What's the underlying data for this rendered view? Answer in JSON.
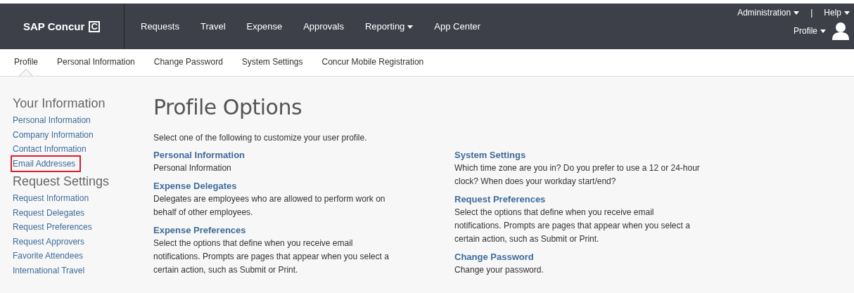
{
  "header": {
    "logo": "SAP Concur",
    "logo_mark": "C",
    "nav": [
      {
        "label": "Requests",
        "has_menu": false
      },
      {
        "label": "Travel",
        "has_menu": false
      },
      {
        "label": "Expense",
        "has_menu": false
      },
      {
        "label": "Approvals",
        "has_menu": false
      },
      {
        "label": "Reporting",
        "has_menu": true
      },
      {
        "label": "App Center",
        "has_menu": false
      }
    ],
    "utility": [
      {
        "label": "Administration",
        "has_menu": true
      },
      {
        "label": "Help",
        "has_menu": true
      }
    ],
    "separator": "|",
    "profile": {
      "label": "Profile",
      "has_menu": true
    }
  },
  "subnav": [
    {
      "label": "Profile",
      "selected": true
    },
    {
      "label": "Personal Information",
      "selected": false
    },
    {
      "label": "Change Password",
      "selected": false
    },
    {
      "label": "System Settings",
      "selected": false
    },
    {
      "label": "Concur Mobile Registration",
      "selected": false
    }
  ],
  "sidebar": [
    {
      "title": "Your Information",
      "items": [
        {
          "label": "Personal Information",
          "highlighted": false
        },
        {
          "label": "Company Information",
          "highlighted": false
        },
        {
          "label": "Contact Information",
          "highlighted": false
        },
        {
          "label": "Email Addresses",
          "highlighted": true
        }
      ]
    },
    {
      "title": "Request Settings",
      "items": [
        {
          "label": "Request Information",
          "highlighted": false
        },
        {
          "label": "Request Delegates",
          "highlighted": false
        },
        {
          "label": "Request Preferences",
          "highlighted": false
        },
        {
          "label": "Request Approvers",
          "highlighted": false
        },
        {
          "label": "Favorite Attendees",
          "highlighted": false
        },
        {
          "label": "International Travel",
          "highlighted": false
        }
      ]
    }
  ],
  "main": {
    "title": "Profile Options",
    "intro": "Select one of the following to customize your user profile.",
    "columns": [
      [
        {
          "title": "Personal Information",
          "description": "Personal Information"
        },
        {
          "title": "Expense Delegates",
          "description": "Delegates are employees who are allowed to perform work on behalf of other employees."
        },
        {
          "title": "Expense Preferences",
          "description": "Select the options that define when you receive email notifications. Prompts are pages that appear when you select a certain action, such as Submit or Print."
        }
      ],
      [
        {
          "title": "System Settings",
          "description": "Which time zone are you in? Do you prefer to use a 12 or 24-hour clock? When does your workday start/end?"
        },
        {
          "title": "Request Preferences",
          "description": "Select the options that define when you receive email notifications. Prompts are pages that appear when you select a certain action, such as Submit or Print."
        },
        {
          "title": "Change Password",
          "description": "Change your password."
        }
      ]
    ]
  }
}
